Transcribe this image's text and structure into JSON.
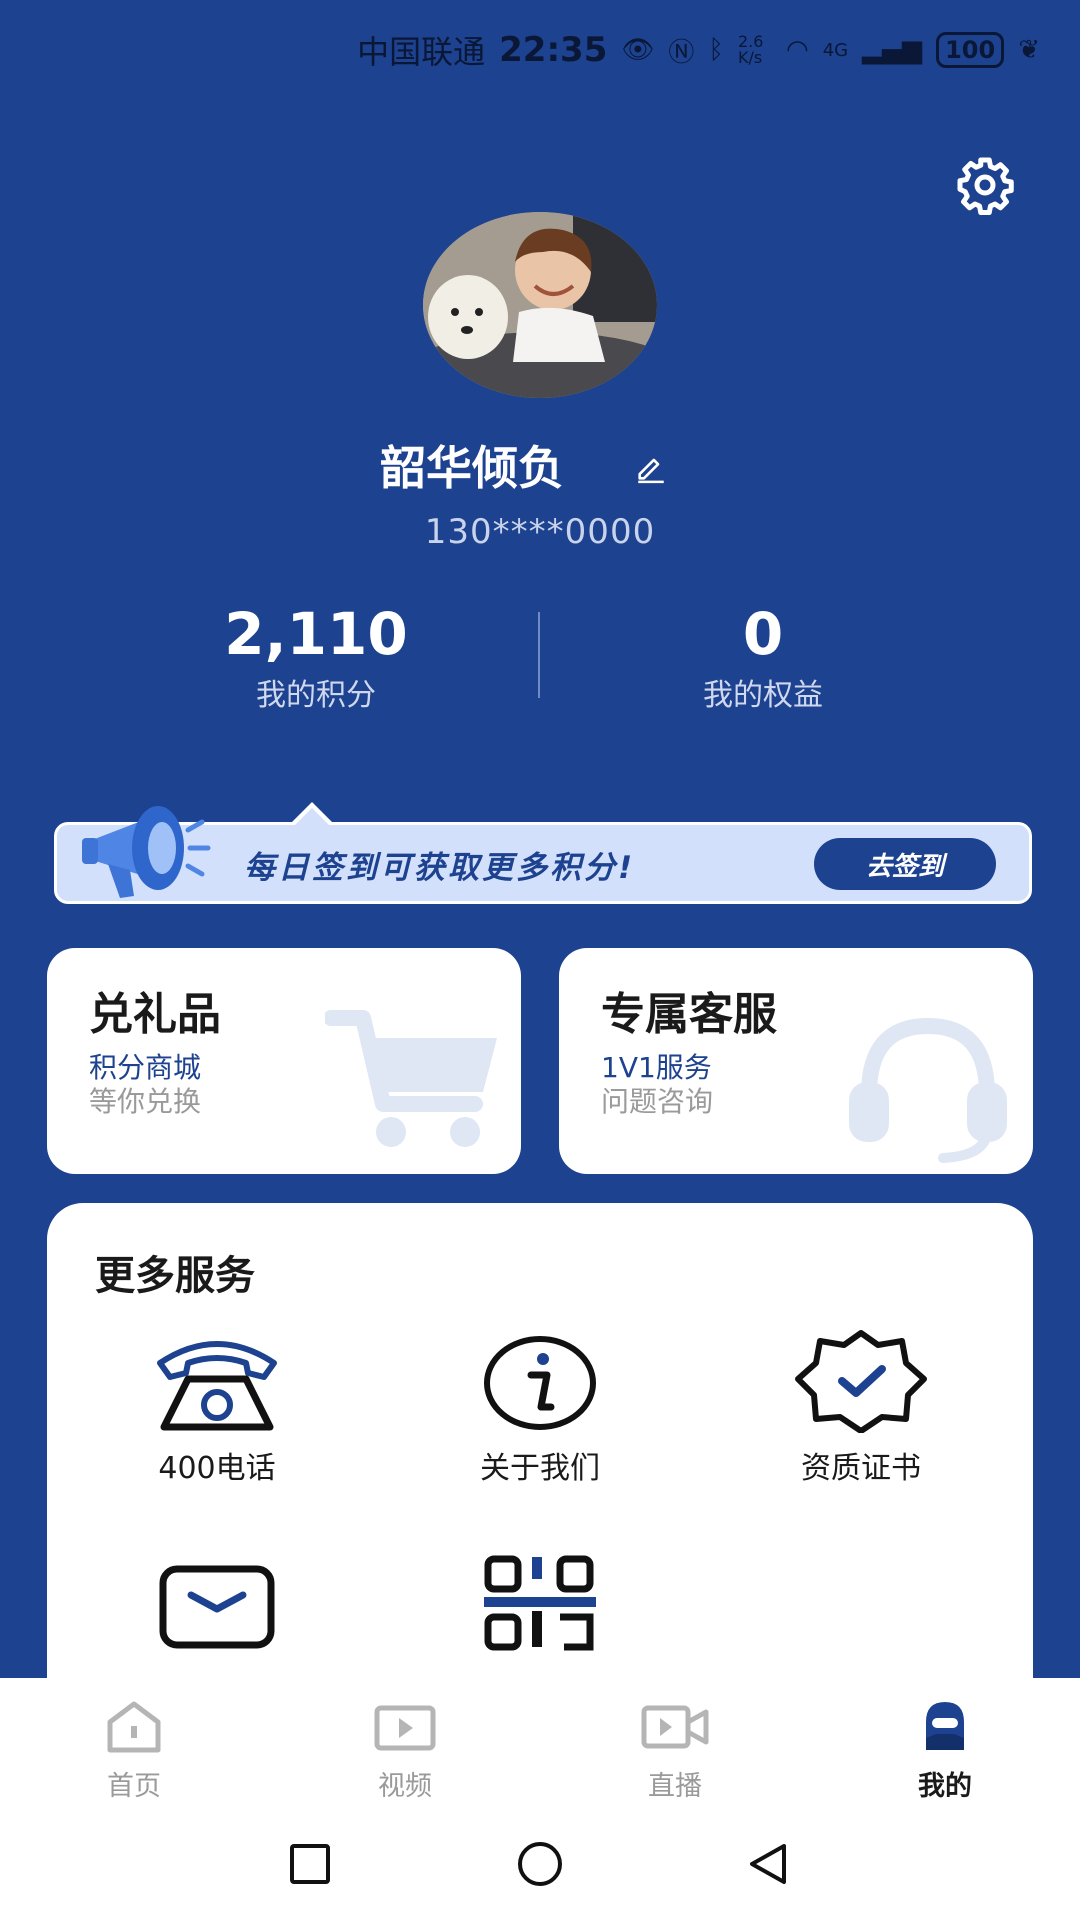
{
  "status_bar": {
    "carrier": "中国联通",
    "time": "22:35",
    "speed": "2.6 K/s",
    "network": "4G",
    "battery": "100"
  },
  "profile": {
    "username": "韶华倾负",
    "phone": "130****0000",
    "points_value": "2,110",
    "points_label": "我的积分",
    "rights_value": "0",
    "rights_label": "我的权益"
  },
  "checkin": {
    "message": "每日签到可获取更多积分!",
    "button": "去签到"
  },
  "cards": {
    "gift": {
      "title": "兑礼品",
      "line1": "积分商城",
      "line2": "等你兑换"
    },
    "service": {
      "title": "专属客服",
      "line1": "1V1服务",
      "line2": "问题咨询"
    }
  },
  "more_services": {
    "title": "更多服务",
    "items": [
      {
        "label": "400电话",
        "icon": "telephone-icon"
      },
      {
        "label": "关于我们",
        "icon": "info-icon"
      },
      {
        "label": "资质证书",
        "icon": "certificate-badge-icon"
      },
      {
        "label": "",
        "icon": "mail-icon"
      },
      {
        "label": "",
        "icon": "qr-code-icon"
      }
    ]
  },
  "tabbar": {
    "tabs": [
      {
        "label": "首页",
        "icon": "home-icon"
      },
      {
        "label": "视频",
        "icon": "video-icon"
      },
      {
        "label": "直播",
        "icon": "live-camera-icon"
      },
      {
        "label": "我的",
        "icon": "profile-icon",
        "active": true
      }
    ]
  },
  "colors": {
    "brand_blue": "#1d428f",
    "banner_bg": "#d3e0fb",
    "card_icon_tint": "#dfe6f4"
  }
}
